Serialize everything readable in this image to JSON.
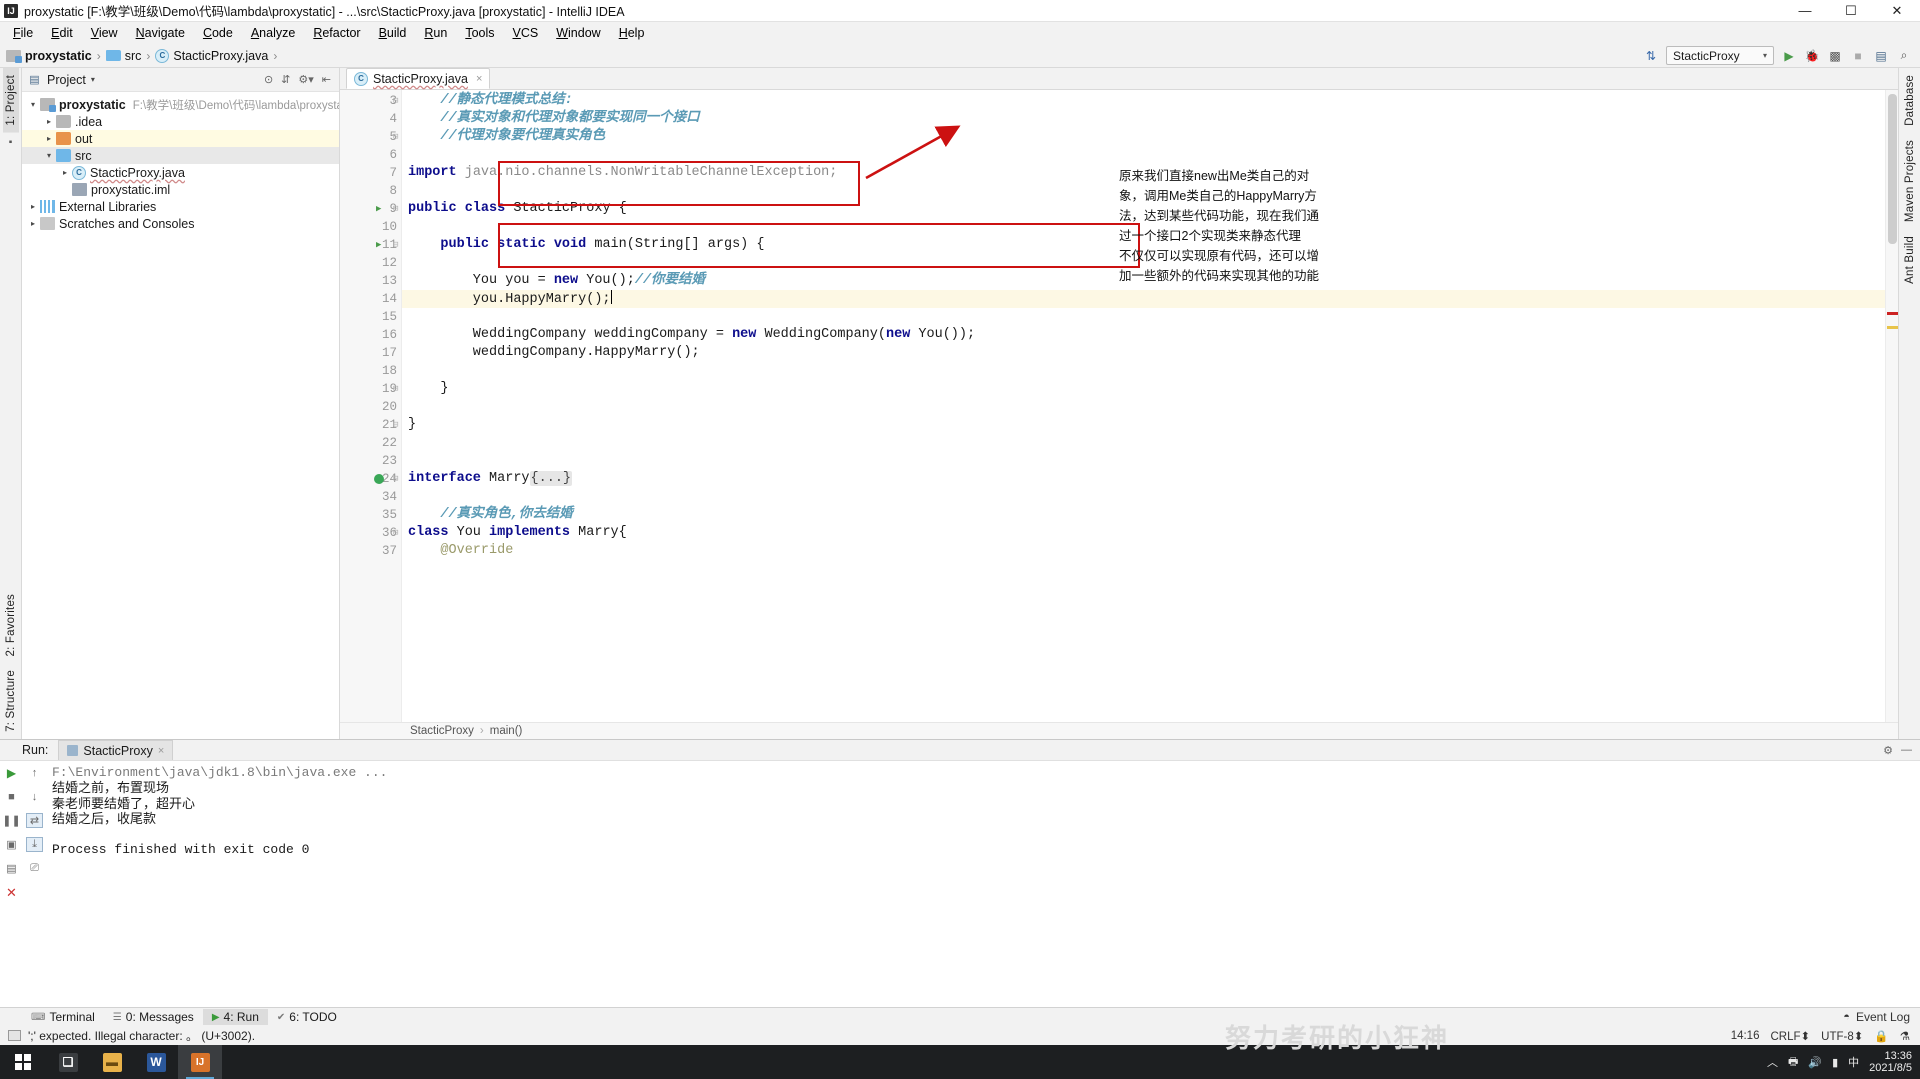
{
  "window": {
    "title": "proxystatic [F:\\教学\\班级\\Demo\\代码\\lambda\\proxystatic] - ...\\src\\StacticProxy.java [proxystatic] - IntelliJ IDEA",
    "logo": "IJ",
    "minimize": "—",
    "maximize": "☐",
    "close": "✕"
  },
  "menubar": {
    "items": [
      "File",
      "Edit",
      "View",
      "Navigate",
      "Code",
      "Analyze",
      "Refactor",
      "Build",
      "Run",
      "Tools",
      "VCS",
      "Window",
      "Help"
    ]
  },
  "breadcrumb": {
    "project": "proxystatic",
    "folder": "src",
    "file": "StacticProxy.java",
    "separator": "›"
  },
  "toolbar": {
    "run_config": "StacticProxy",
    "run_icon": "▶",
    "debug_icon": "ὁE",
    "coverage_icon": "▦",
    "stop_icon": "■",
    "search_icon": "⌕",
    "updates_icon": "⇅"
  },
  "left_tabs": [
    {
      "label": "1: Project",
      "selected": true
    },
    {
      "label": "2: Favorites",
      "selected": false
    },
    {
      "label": "7: Structure",
      "selected": false
    }
  ],
  "right_tabs": [
    {
      "label": "Database"
    },
    {
      "label": "Maven Projects"
    },
    {
      "label": "Ant Build"
    }
  ],
  "project_panel": {
    "header": "Project",
    "caret": "▾",
    "tools": [
      "⊙",
      "⇕",
      "⚙",
      "⇤"
    ],
    "tree": [
      {
        "indent": 0,
        "arrow": "⌄",
        "icon": "module",
        "label": "proxystatic",
        "bold": true,
        "path": "F:\\教学\\班级\\Demo\\代码\\lambda\\proxystatic",
        "highlight": ""
      },
      {
        "indent": 1,
        "arrow": "›",
        "icon": "folder-gray",
        "label": ".idea",
        "bold": false,
        "path": "",
        "highlight": ""
      },
      {
        "indent": 1,
        "arrow": "›",
        "icon": "folder-orange",
        "label": "out",
        "bold": false,
        "path": "",
        "highlight": "out"
      },
      {
        "indent": 1,
        "arrow": "⌄",
        "icon": "folder-blue",
        "label": "src",
        "bold": false,
        "path": "",
        "highlight": "src"
      },
      {
        "indent": 2,
        "arrow": "›",
        "icon": "java",
        "label": "StacticProxy.java",
        "bold": false,
        "path": "",
        "highlight": ""
      },
      {
        "indent": 2,
        "arrow": "",
        "icon": "iml",
        "label": "proxystatic.iml",
        "bold": false,
        "path": "",
        "highlight": ""
      },
      {
        "indent": 0,
        "arrow": "›",
        "icon": "lib",
        "label": "External Libraries",
        "bold": false,
        "path": "",
        "highlight": ""
      },
      {
        "indent": 0,
        "arrow": "›",
        "icon": "scratch",
        "label": "Scratches and Consoles",
        "bold": false,
        "path": "",
        "highlight": ""
      }
    ]
  },
  "editor": {
    "tab": {
      "label": "StacticProxy.java",
      "close": "×",
      "icon": "C"
    },
    "breadcrumb": {
      "class": "StacticProxy",
      "method": "main()",
      "separator": "›"
    },
    "lines": [
      {
        "num": "3",
        "marks": {
          "fold": "⊟"
        },
        "segments": [
          {
            "t": "    ",
            "c": ""
          },
          {
            "t": "//静态代理模式总结:",
            "c": "cmt"
          }
        ]
      },
      {
        "num": "4",
        "marks": {},
        "segments": [
          {
            "t": "    ",
            "c": ""
          },
          {
            "t": "//真实对象和代理对象都要实现同一个接口",
            "c": "cmt"
          }
        ]
      },
      {
        "num": "5",
        "marks": {
          "fold": "⊟"
        },
        "segments": [
          {
            "t": "    ",
            "c": ""
          },
          {
            "t": "//代理对象要代理真实角色",
            "c": "cmt"
          }
        ]
      },
      {
        "num": "6",
        "marks": {},
        "segments": []
      },
      {
        "num": "7",
        "marks": {},
        "segments": [
          {
            "t": "import ",
            "c": "kw"
          },
          {
            "t": "java.nio.channels.NonWritableChannelException;",
            "c": "dim"
          }
        ]
      },
      {
        "num": "8",
        "marks": {},
        "segments": []
      },
      {
        "num": "9",
        "marks": {
          "run": "▶",
          "fold": "⊟"
        },
        "segments": [
          {
            "t": "public class ",
            "c": "kw"
          },
          {
            "t": "StacticProxy {",
            "c": ""
          }
        ]
      },
      {
        "num": "10",
        "marks": {},
        "segments": []
      },
      {
        "num": "11",
        "marks": {
          "run": "▶",
          "fold": "⊟"
        },
        "segments": [
          {
            "t": "    ",
            "c": ""
          },
          {
            "t": "public static void ",
            "c": "kw"
          },
          {
            "t": "main(String[] args) {",
            "c": ""
          }
        ]
      },
      {
        "num": "12",
        "marks": {},
        "segments": []
      },
      {
        "num": "13",
        "marks": {},
        "segments": [
          {
            "t": "        You you = ",
            "c": ""
          },
          {
            "t": "new ",
            "c": "kw"
          },
          {
            "t": "You();",
            "c": ""
          },
          {
            "t": "//你要结婚",
            "c": "cmt"
          }
        ]
      },
      {
        "num": "14",
        "marks": {},
        "current": true,
        "segments": [
          {
            "t": "        you.HappyMarry();",
            "c": ""
          }
        ],
        "caret": true
      },
      {
        "num": "15",
        "marks": {},
        "segments": []
      },
      {
        "num": "16",
        "marks": {},
        "segments": [
          {
            "t": "        WeddingCompany weddingCompany = ",
            "c": ""
          },
          {
            "t": "new ",
            "c": "kw"
          },
          {
            "t": "WeddingCompany(",
            "c": ""
          },
          {
            "t": "new ",
            "c": "kw"
          },
          {
            "t": "You());",
            "c": ""
          }
        ]
      },
      {
        "num": "17",
        "marks": {},
        "segments": [
          {
            "t": "        weddingCompany.HappyMarry();",
            "c": ""
          }
        ]
      },
      {
        "num": "18",
        "marks": {},
        "segments": []
      },
      {
        "num": "19",
        "marks": {
          "fold": "⊟"
        },
        "segments": [
          {
            "t": "    }",
            "c": ""
          }
        ]
      },
      {
        "num": "20",
        "marks": {},
        "segments": []
      },
      {
        "num": "21",
        "marks": {
          "fold": "⊟"
        },
        "segments": [
          {
            "t": "}",
            "c": ""
          }
        ]
      },
      {
        "num": "22",
        "marks": {},
        "segments": []
      },
      {
        "num": "23",
        "marks": {},
        "segments": []
      },
      {
        "num": "24",
        "marks": {
          "bulb": "ℹ",
          "fold": "⊟"
        },
        "segments": [
          {
            "t": "interface ",
            "c": "kw"
          },
          {
            "t": "Marry",
            "c": ""
          },
          {
            "t": "{...}",
            "c": "foldblk"
          }
        ]
      },
      {
        "num": "34",
        "marks": {},
        "segments": []
      },
      {
        "num": "35",
        "marks": {},
        "segments": [
          {
            "t": "    ",
            "c": ""
          },
          {
            "t": "//真实角色,你去结婚",
            "c": "cmt"
          }
        ]
      },
      {
        "num": "36",
        "marks": {
          "fold": "⊟"
        },
        "segments": [
          {
            "t": "class ",
            "c": "kw"
          },
          {
            "t": "You ",
            "c": ""
          },
          {
            "t": "implements ",
            "c": "kw"
          },
          {
            "t": "Marry{",
            "c": ""
          }
        ]
      },
      {
        "num": "37",
        "marks": {},
        "segments": [
          {
            "t": "    ",
            "c": ""
          },
          {
            "t": "@Override",
            "c": "anno"
          }
        ]
      }
    ],
    "annotation": "原来我们直接new出Me类自己的对象，调用Me类自己的HappyMarry方法，达到某些代码功能，现在我们通过一个接口2个实现类来静态代理\n不仅仅可以实现原有代码，还可以增加一些额外的代码来实现其他的功能"
  },
  "colors": {
    "highlight_box": "#cc1111",
    "keyword": "#0d0d8c",
    "comment": "#5a9ab5",
    "current_line": "#fdf8e4",
    "accent_green": "#3a9a3a"
  },
  "run_panel": {
    "label": "Run:",
    "tab": "StacticProxy",
    "tab_close": "×",
    "gear": "⚙",
    "minimize": "—",
    "tools_left": [
      "▶",
      "■",
      "⏸",
      "▣",
      "✕"
    ],
    "tools_right": [
      "↑",
      "↓",
      "↺",
      "↓̲",
      "⎘",
      "⌧"
    ],
    "console": {
      "command": "F:\\Environment\\java\\jdk1.8\\bin\\java.exe ...",
      "output": [
        "结婚之前，布置现场",
        "秦老师要结婚了，超开心",
        "结婚之后，收尾款"
      ],
      "finished": "Process finished with exit code 0"
    }
  },
  "status_tabs": {
    "items": [
      {
        "label": "Terminal",
        "icon": "⌨",
        "selected": false
      },
      {
        "label": "0: Messages",
        "icon": "☰",
        "selected": false
      },
      {
        "label": "4: Run",
        "icon": "▶",
        "selected": true
      },
      {
        "label": "6: TODO",
        "icon": "✔",
        "selected": false
      }
    ],
    "event_log": "Event Log",
    "event_log_icon": "⚲"
  },
  "status_bar": {
    "message": "';' expected. Illegal character: 。 (U+3002).",
    "icon": "☐",
    "position": "14:16",
    "line_sep": "CRLF⬍",
    "encoding": "UTF-8⬍",
    "lock": "ὑ2",
    "inspection": "⚙"
  },
  "watermark": "努力考研的小狂神",
  "taskbar": {
    "start_icon": "windows-logo",
    "apps": [
      {
        "name": "task-view",
        "glyph": "❐",
        "color": "#2d2f31",
        "active": false
      },
      {
        "name": "file-explorer",
        "glyph": "Ὄ1",
        "color": "#e8b24a",
        "active": false
      },
      {
        "name": "word",
        "glyph": "W",
        "color": "#2b579a",
        "active": false
      },
      {
        "name": "intellij-idea",
        "glyph": "IJ",
        "color": "#d8732a",
        "active": true
      }
    ],
    "tray_icons": [
      "▲",
      "὚8",
      "ὐA",
      "὏6"
    ],
    "clock_time": "13:36",
    "clock_date": "2021/8/5"
  }
}
